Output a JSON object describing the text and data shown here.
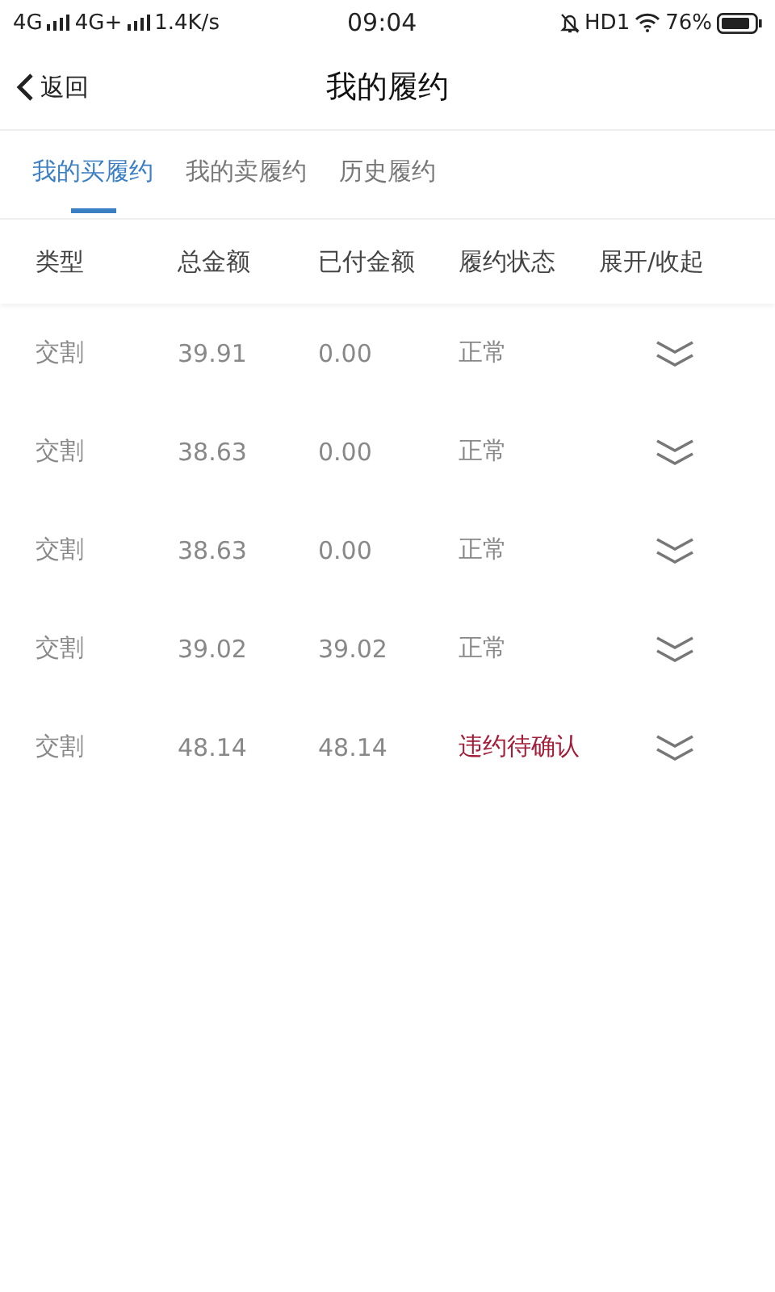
{
  "status_bar": {
    "network_1": "4G",
    "network_2": "4G+",
    "speed": "1.4K/s",
    "time": "09:04",
    "hd": "HD1",
    "battery": "76%"
  },
  "nav": {
    "back": "返回",
    "title": "我的履约"
  },
  "tabs": [
    {
      "label": "我的买履约",
      "selected": true
    },
    {
      "label": "我的卖履约",
      "selected": false
    },
    {
      "label": "历史履约",
      "selected": false
    }
  ],
  "table": {
    "columns": [
      "类型",
      "总金额",
      "已付金额",
      "履约状态",
      "展开/收起"
    ],
    "rows": [
      {
        "type": "交割",
        "total": "39.91",
        "paid": "0.00",
        "status": "正常",
        "kind": "normal"
      },
      {
        "type": "交割",
        "total": "38.63",
        "paid": "0.00",
        "status": "正常",
        "kind": "normal"
      },
      {
        "type": "交割",
        "total": "38.63",
        "paid": "0.00",
        "status": "正常",
        "kind": "normal"
      },
      {
        "type": "交割",
        "total": "39.02",
        "paid": "39.02",
        "status": "正常",
        "kind": "normal"
      },
      {
        "type": "交割",
        "total": "48.14",
        "paid": "48.14",
        "status": "违约待确认",
        "kind": "breach"
      }
    ]
  }
}
